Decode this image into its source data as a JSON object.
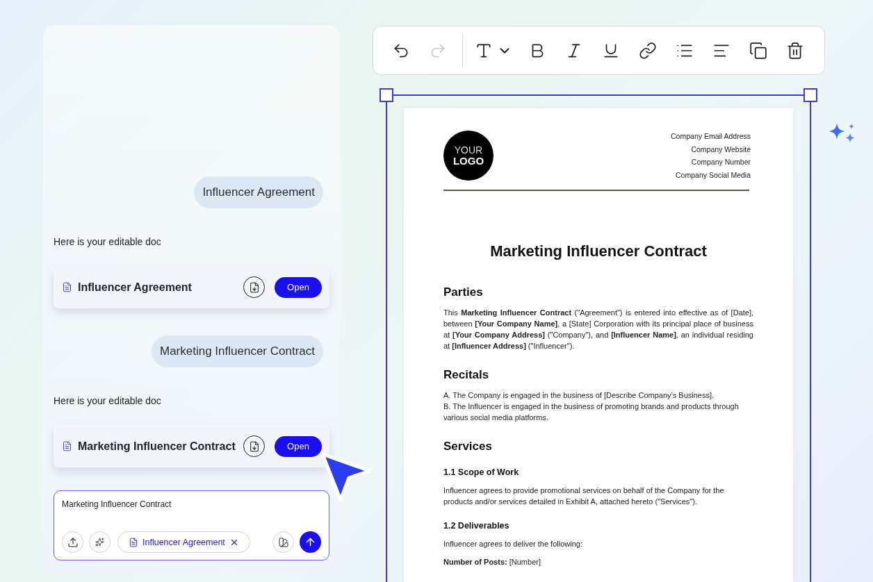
{
  "chat": {
    "messages": [
      {
        "kind": "user",
        "text": "Influencer Agreement"
      },
      {
        "kind": "bot",
        "text": "Here is your editable doc"
      },
      {
        "kind": "doc",
        "title": "Influencer Agreement",
        "action": "Open"
      },
      {
        "kind": "user",
        "text": "Marketing Influencer Contract"
      },
      {
        "kind": "bot",
        "text": "Here is your editable doc"
      },
      {
        "kind": "doc",
        "title": "Marketing Influencer Contract",
        "action": "Open"
      }
    ]
  },
  "composer": {
    "value": "Marketing Influencer Contract",
    "attachment": "Influencer Agreement"
  },
  "toolbar": {
    "tools": [
      {
        "kind": "undo",
        "disabled": false
      },
      {
        "kind": "redo",
        "disabled": true
      },
      {
        "kind": "divider"
      },
      {
        "kind": "text-style",
        "disabled": false
      },
      {
        "kind": "bold",
        "disabled": false
      },
      {
        "kind": "italic",
        "disabled": false
      },
      {
        "kind": "underline",
        "disabled": false
      },
      {
        "kind": "link",
        "disabled": false
      },
      {
        "kind": "list",
        "disabled": false
      },
      {
        "kind": "align",
        "disabled": false
      },
      {
        "kind": "duplicate",
        "disabled": false
      },
      {
        "kind": "delete",
        "disabled": false
      }
    ]
  },
  "document": {
    "logo": [
      "YOUR",
      "LOGO"
    ],
    "contacts": [
      "Company Email Address",
      "Company Website",
      "Company Number",
      "Company Social Media"
    ],
    "title": "Marketing Influencer Contract",
    "blocks": [
      {
        "kind": "heading",
        "text": "Parties"
      },
      {
        "kind": "justified",
        "text": "This **Marketing Influencer Contract** (\"Agreement\") is entered into effective as of [Date], between **[Your Company Name]**, a [State] Corporation with its principal place of business at **[Your Company Address]** (\"Company\"), and **[Influencer Name]**, an individual residing at **[Influencer Address]** (\"Influencer\")."
      },
      {
        "kind": "heading",
        "text": "Recitals"
      },
      {
        "kind": "line",
        "text": "A. The Company is engaged in the business of [Describe Company’s Business]."
      },
      {
        "kind": "line",
        "text": "B. The Influencer is engaged in the business of promoting brands and products through various social media platforms."
      },
      {
        "kind": "heading",
        "text": "Services"
      },
      {
        "kind": "subheading",
        "text": "1.1 Scope of Work"
      },
      {
        "kind": "paragraph",
        "text": "Influencer agrees to provide promotional services on behalf of the Company for the products and/or services detailed in Exhibit A, attached hereto (\"Services\")."
      },
      {
        "kind": "subheading",
        "text": "1.2 Deliverables"
      },
      {
        "kind": "paragraph",
        "text": "Influencer agrees to deliver the following:"
      },
      {
        "kind": "field",
        "text": "**Number of Posts:** [Number]"
      }
    ]
  }
}
